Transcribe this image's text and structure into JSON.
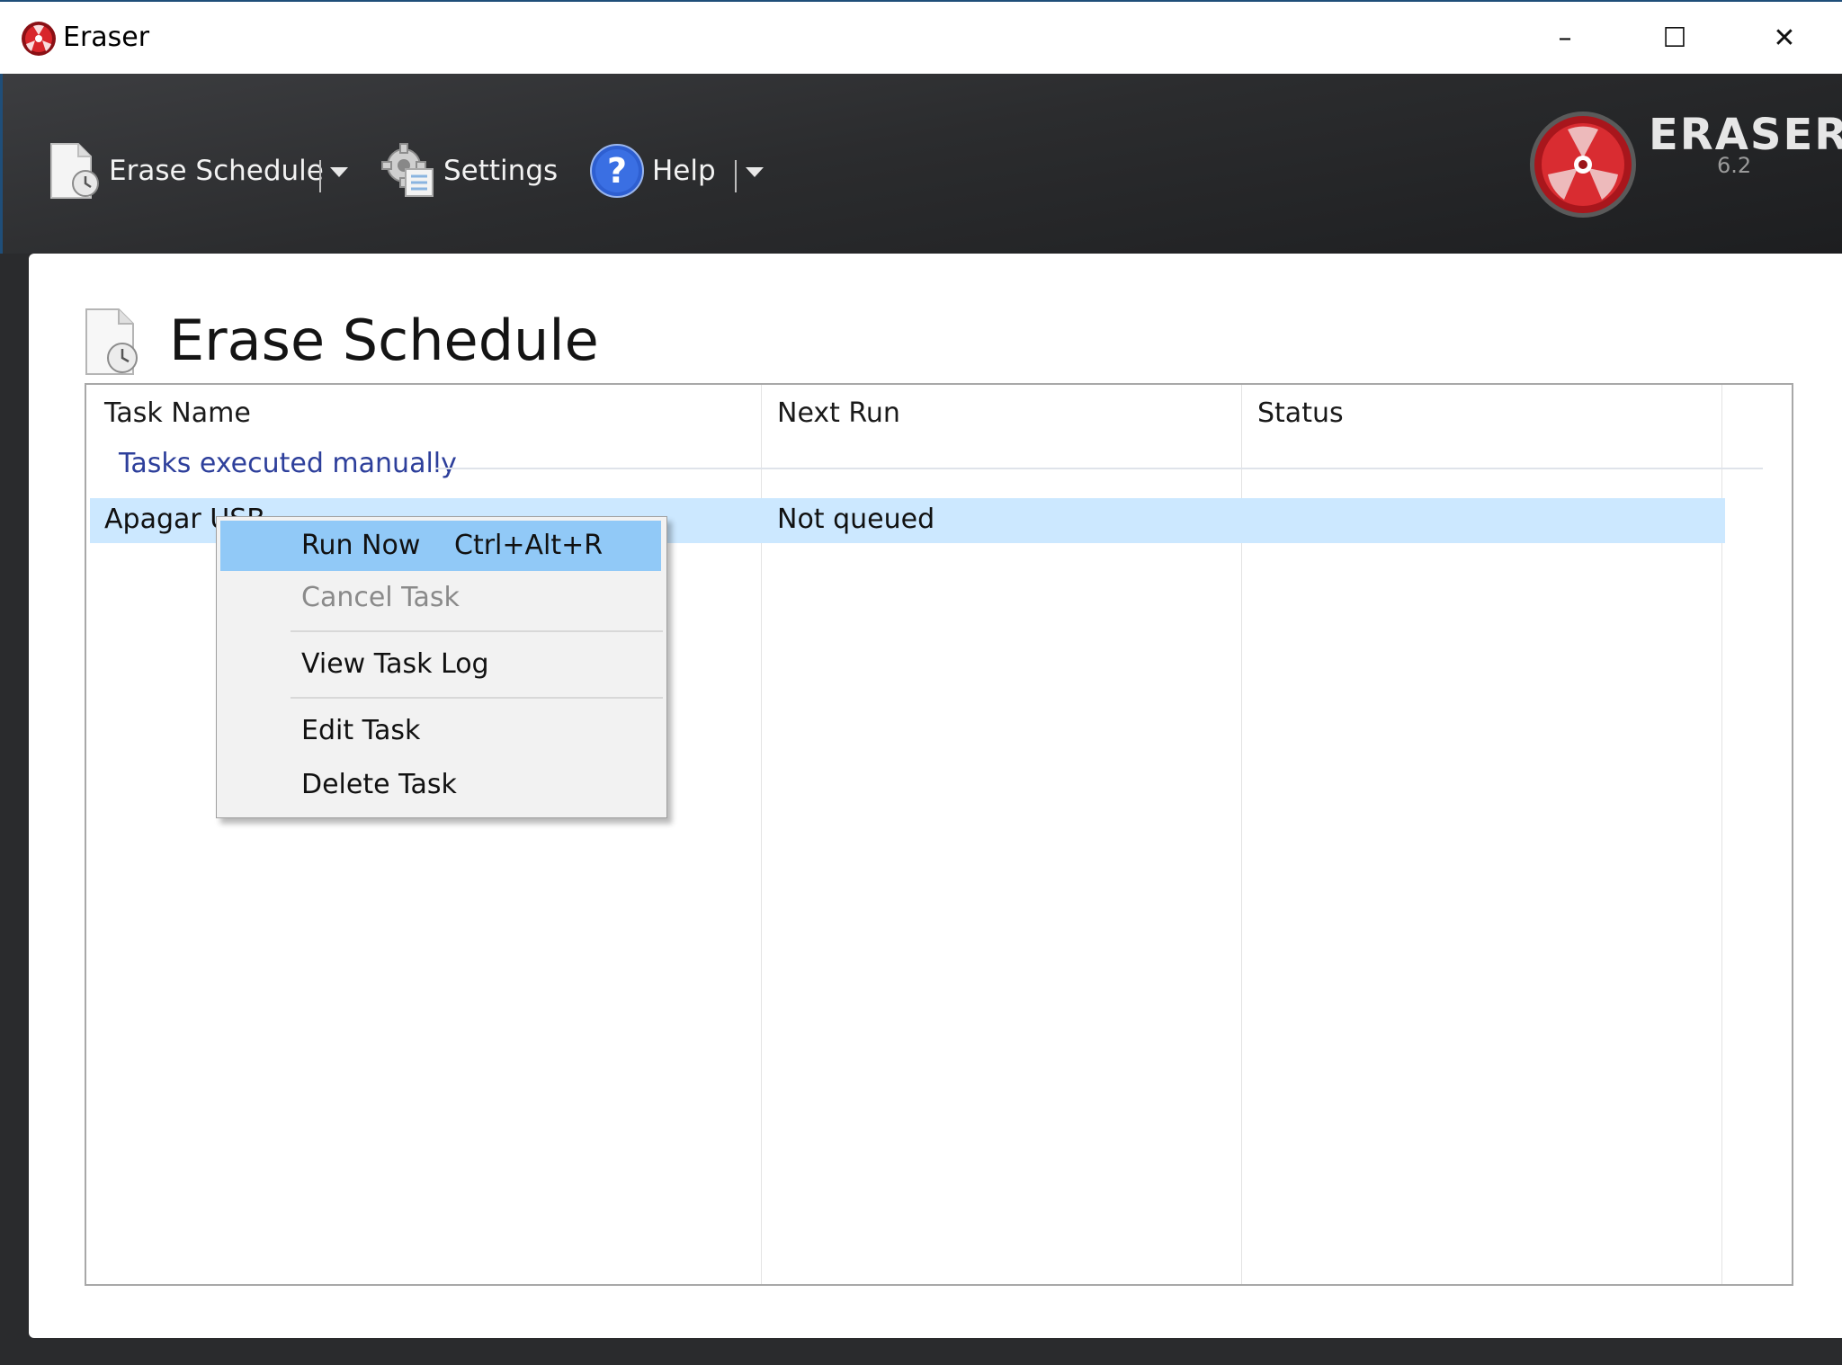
{
  "window": {
    "title": "Eraser",
    "controls": {
      "minimize": "–",
      "maximize": "☐",
      "close": "✕"
    }
  },
  "toolbar": {
    "erase_schedule_label": "Erase Schedule",
    "settings_label": "Settings",
    "help_label": "Help",
    "logo_text": "ERASER",
    "version": "6.2"
  },
  "main": {
    "page_title": "Erase Schedule",
    "columns": [
      "Task Name",
      "Next Run",
      "Status"
    ],
    "group_label": "Tasks executed manually",
    "rows": [
      {
        "task_name": "Apagar USB",
        "next_run": "Not queued",
        "status": ""
      }
    ]
  },
  "context_menu": {
    "items": [
      {
        "label": "Run Now",
        "shortcut": "Ctrl+Alt+R",
        "highlighted": true,
        "disabled": false
      },
      {
        "label": "Cancel Task",
        "shortcut": "",
        "highlighted": false,
        "disabled": true
      },
      {
        "label": "View Task Log",
        "shortcut": "",
        "highlighted": false,
        "disabled": false
      },
      {
        "label": "Edit Task",
        "shortcut": "",
        "highlighted": false,
        "disabled": false
      },
      {
        "label": "Delete Task",
        "shortcut": "",
        "highlighted": false,
        "disabled": false
      }
    ]
  },
  "colors": {
    "selection": "#cce8ff",
    "menu_highlight": "#91c9f7",
    "group_label": "#2d3f9b",
    "accent_red": "#c0161b"
  },
  "icons": [
    "eraser-app-icon",
    "erase-schedule-icon",
    "settings-gear-icon",
    "help-question-icon",
    "eraser-logo-icon",
    "page-schedule-icon"
  ]
}
